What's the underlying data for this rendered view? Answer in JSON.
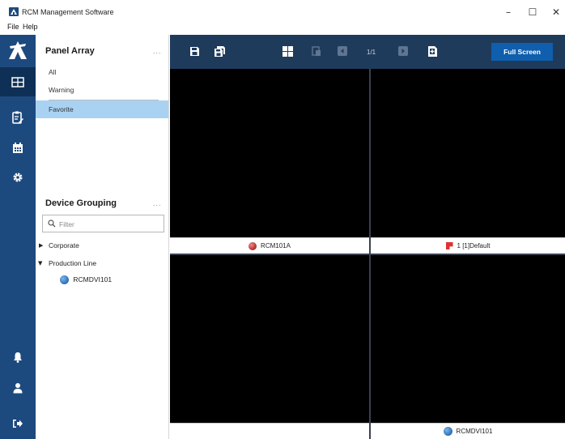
{
  "window": {
    "title": "RCM Management Software",
    "minimize_glyph": "–",
    "maximize_glyph": "☐",
    "close_glyph": "✕"
  },
  "menu": {
    "file": "File",
    "help": "Help"
  },
  "rail": {
    "items": [
      {
        "icon": "screens-icon",
        "active": true
      },
      {
        "icon": "edit-list-icon",
        "active": false
      },
      {
        "icon": "calendar-icon",
        "active": false
      },
      {
        "icon": "gear-icon",
        "active": false
      },
      {
        "icon": "bell-icon",
        "active": false
      },
      {
        "icon": "user-icon",
        "active": false
      },
      {
        "icon": "logout-icon",
        "active": false
      }
    ],
    "accent": "#1d4a7e"
  },
  "panel_array": {
    "title": "Panel Array",
    "more": "...",
    "items": [
      "All",
      "Warning",
      "Favorite"
    ],
    "selected": "Favorite"
  },
  "device_grouping": {
    "title": "Device Grouping",
    "more": "...",
    "filter_placeholder": "Filter",
    "tree": [
      {
        "label": "Corporate",
        "expanded": false,
        "arrow": "▶"
      },
      {
        "label": "Production Line",
        "expanded": true,
        "arrow": "▼",
        "children": [
          "RCMDVI101"
        ]
      }
    ]
  },
  "toolbar": {
    "page_indicator": "1/1",
    "fullscreen_label": "Full Screen",
    "icons": [
      "save-icon",
      "save-as-icon",
      "layout-grid-icon",
      "copy-icon",
      "prev-icon",
      "next-icon",
      "add-page-icon"
    ]
  },
  "screens": [
    {
      "label": "RCM101A",
      "icon": "red-device-icon",
      "selected": true
    },
    {
      "label": "1 [1]Default",
      "icon": "red-flag-icon",
      "selected": false
    },
    {
      "label": "",
      "icon": "",
      "selected": false
    },
    {
      "label": "RCMDVI101",
      "icon": "globe-icon",
      "selected": false
    }
  ],
  "colors": {
    "selection": "#a9d2f2",
    "toolbar": "#1f3b5c",
    "button": "#0f5fae",
    "selected_border": "#8cc63f"
  }
}
